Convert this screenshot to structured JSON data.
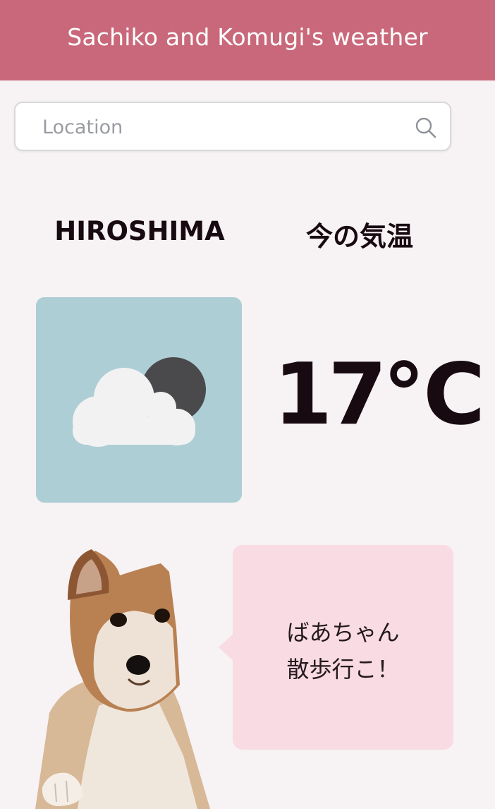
{
  "header": {
    "title": "Sachiko and Komugi's weather"
  },
  "search": {
    "placeholder": "Location",
    "icon": "search-icon"
  },
  "weather": {
    "city": "HIROSHIMA",
    "temp_label": "今の気温",
    "temperature": "17℃",
    "condition_icon": "cloud-night-icon"
  },
  "speech": {
    "line1": "ばあちゃん",
    "line2": "散歩行こ！"
  },
  "colors": {
    "header_bg": "#c9687a",
    "page_bg": "#f7f2f4",
    "weather_tile_bg": "#aeced5",
    "bubble_bg": "#f9dbe3",
    "text_dark": "#170a10"
  }
}
